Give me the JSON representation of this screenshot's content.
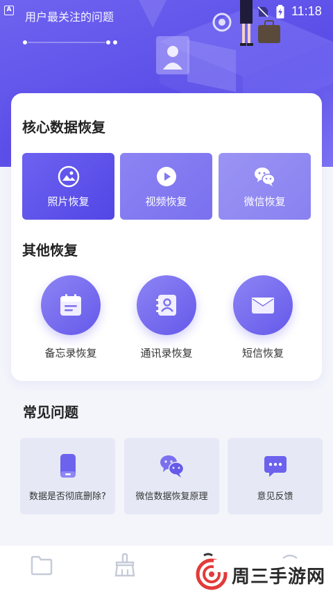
{
  "status_bar": {
    "app_icon_letter": "A",
    "time": "11:18"
  },
  "hero": {
    "subtitle": "用户最关注的问题"
  },
  "core_section": {
    "title": "核心数据恢复",
    "items": [
      {
        "label": "照片恢复",
        "icon": "photo-icon"
      },
      {
        "label": "视频恢复",
        "icon": "video-play-icon"
      },
      {
        "label": "微信恢复",
        "icon": "wechat-icon"
      }
    ]
  },
  "other_section": {
    "title": "其他恢复",
    "items": [
      {
        "label": "备忘录恢复",
        "icon": "memo-icon"
      },
      {
        "label": "通讯录恢复",
        "icon": "contacts-icon"
      },
      {
        "label": "短信恢复",
        "icon": "envelope-icon"
      }
    ]
  },
  "faq_section": {
    "title": "常见问题",
    "items": [
      {
        "label": "数据是否彻底删除?",
        "icon": "phone-icon"
      },
      {
        "label": "微信数据恢复原理",
        "icon": "wechat-icon"
      },
      {
        "label": "意见反馈",
        "icon": "chat-bubble-icon"
      }
    ]
  },
  "bottom_nav": {
    "items": [
      {
        "icon": "folder-icon"
      },
      {
        "icon": "broom-icon"
      },
      {
        "icon": "profile-icon"
      },
      {
        "icon": "settings-icon"
      }
    ]
  },
  "watermark": {
    "text": "周三手游网"
  },
  "colors": {
    "accent": "#5b4ee8",
    "accent_light": "#8c84f3",
    "page_background": "#f3f5fb",
    "faq_card": "#e6e9f5"
  }
}
